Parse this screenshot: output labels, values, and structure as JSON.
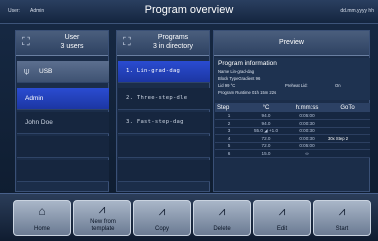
{
  "topbar": {
    "user_label": "User:",
    "user_value": "Admin",
    "title": "Program overview",
    "datetime": "dd.mm.yyyy hh"
  },
  "users": {
    "title": "User",
    "subtitle": "3 users",
    "items": [
      {
        "label": "USB",
        "state": "usb"
      },
      {
        "label": "Admin",
        "state": "selected"
      },
      {
        "label": "John Doe",
        "state": "normal"
      }
    ]
  },
  "programs": {
    "title": "Programs",
    "subtitle": "3 in directory",
    "items": [
      {
        "label": "1. Lin-grad-dag",
        "state": "selected"
      },
      {
        "label": "2. Three-step-dle",
        "state": "normal"
      },
      {
        "label": "3. Fast-step-dag",
        "state": "normal"
      }
    ]
  },
  "preview": {
    "title": "Preview",
    "info_title": "Program information",
    "name_line": "Name   Lin-grad-dag",
    "block_line": "Block TypeGradient  96",
    "lid_line": "Lid          99 °C",
    "preheat_line": "Preheat Lid:",
    "preheat_value": "On",
    "runtime_line": "Program Runtime   01h 15m 22s"
  },
  "steps": {
    "headers": [
      "Step",
      "°C",
      "h:mm:ss",
      "GoTo"
    ],
    "rows": [
      [
        "1",
        "94.0",
        "0:05:00",
        ""
      ],
      [
        "2",
        "94.0",
        "0:00:30",
        ""
      ],
      [
        "3",
        "55.0 ◢ +1.0",
        "0:00:30",
        ""
      ],
      [
        "4",
        "72.0",
        "0:00:30",
        "30x  Step    2"
      ],
      [
        "5",
        "72.0",
        "0:05:00",
        ""
      ],
      [
        "6",
        "15.0",
        "∞",
        ""
      ]
    ]
  },
  "toolbar": {
    "buttons": [
      {
        "label": "Home",
        "icon": "home-icon"
      },
      {
        "label": "New from template",
        "icon": "new-program-icon"
      },
      {
        "label": "Copy",
        "icon": "copy-icon"
      },
      {
        "label": "Delete",
        "icon": "delete-icon"
      },
      {
        "label": "Edit",
        "icon": "edit-icon"
      },
      {
        "label": "Start",
        "icon": "start-icon"
      }
    ]
  }
}
